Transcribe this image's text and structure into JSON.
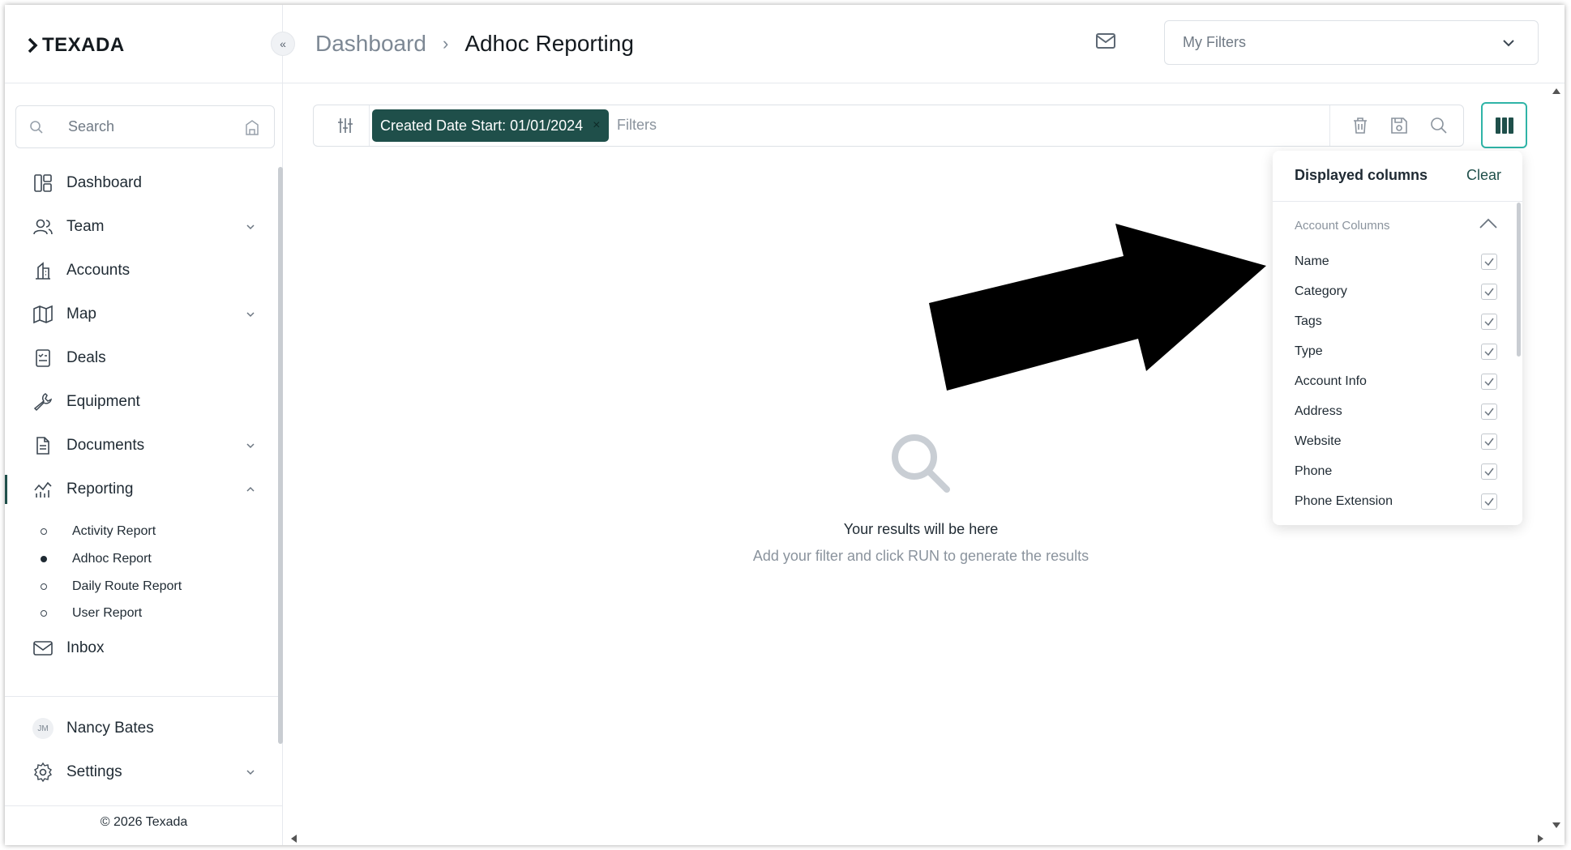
{
  "app": {
    "logo_text": "TEXADA"
  },
  "header": {
    "breadcrumb_parent": "Dashboard",
    "breadcrumb_current": "Adhoc Reporting",
    "my_filters_placeholder": "My Filters"
  },
  "sidebar": {
    "search_placeholder": "Search",
    "items": [
      {
        "label": "Dashboard",
        "icon": "dashboard-icon"
      },
      {
        "label": "Team",
        "icon": "team-icon",
        "expandable": true
      },
      {
        "label": "Accounts",
        "icon": "building-icon"
      },
      {
        "label": "Map",
        "icon": "map-icon",
        "expandable": true
      },
      {
        "label": "Deals",
        "icon": "deals-icon"
      },
      {
        "label": "Equipment",
        "icon": "wrench-icon"
      },
      {
        "label": "Documents",
        "icon": "document-icon",
        "expandable": true
      },
      {
        "label": "Reporting",
        "icon": "chart-icon",
        "expandable": true,
        "expanded": true,
        "active": true
      },
      {
        "label": "Inbox",
        "icon": "mail-icon"
      }
    ],
    "reporting_sub": [
      {
        "label": "Activity Report",
        "selected": false
      },
      {
        "label": "Adhoc Report",
        "selected": true
      },
      {
        "label": "Daily Route Report",
        "selected": false
      },
      {
        "label": "User Report",
        "selected": false
      }
    ],
    "user": {
      "initials": "JM",
      "name": "Nancy Bates"
    },
    "settings_label": "Settings",
    "copyright": "© 2026 Texada"
  },
  "filterbar": {
    "chip_label": "Created Date Start: 01/01/2024",
    "chip_close": "×",
    "placeholder": "Filters"
  },
  "empty_state": {
    "title": "Your results will be here",
    "subtitle": "Add your filter and click RUN to generate the results"
  },
  "columns_panel": {
    "title": "Displayed columns",
    "clear_label": "Clear",
    "group_title": "Account Columns",
    "columns": [
      {
        "label": "Name",
        "checked": true
      },
      {
        "label": "Category",
        "checked": true
      },
      {
        "label": "Tags",
        "checked": true
      },
      {
        "label": "Type",
        "checked": true
      },
      {
        "label": "Account Info",
        "checked": true
      },
      {
        "label": "Address",
        "checked": true
      },
      {
        "label": "Website",
        "checked": true
      },
      {
        "label": "Phone",
        "checked": true
      },
      {
        "label": "Phone Extension",
        "checked": true
      }
    ]
  },
  "colors": {
    "brand_dark_teal": "#1f4f4a",
    "accent_teal": "#2fb4a7"
  }
}
